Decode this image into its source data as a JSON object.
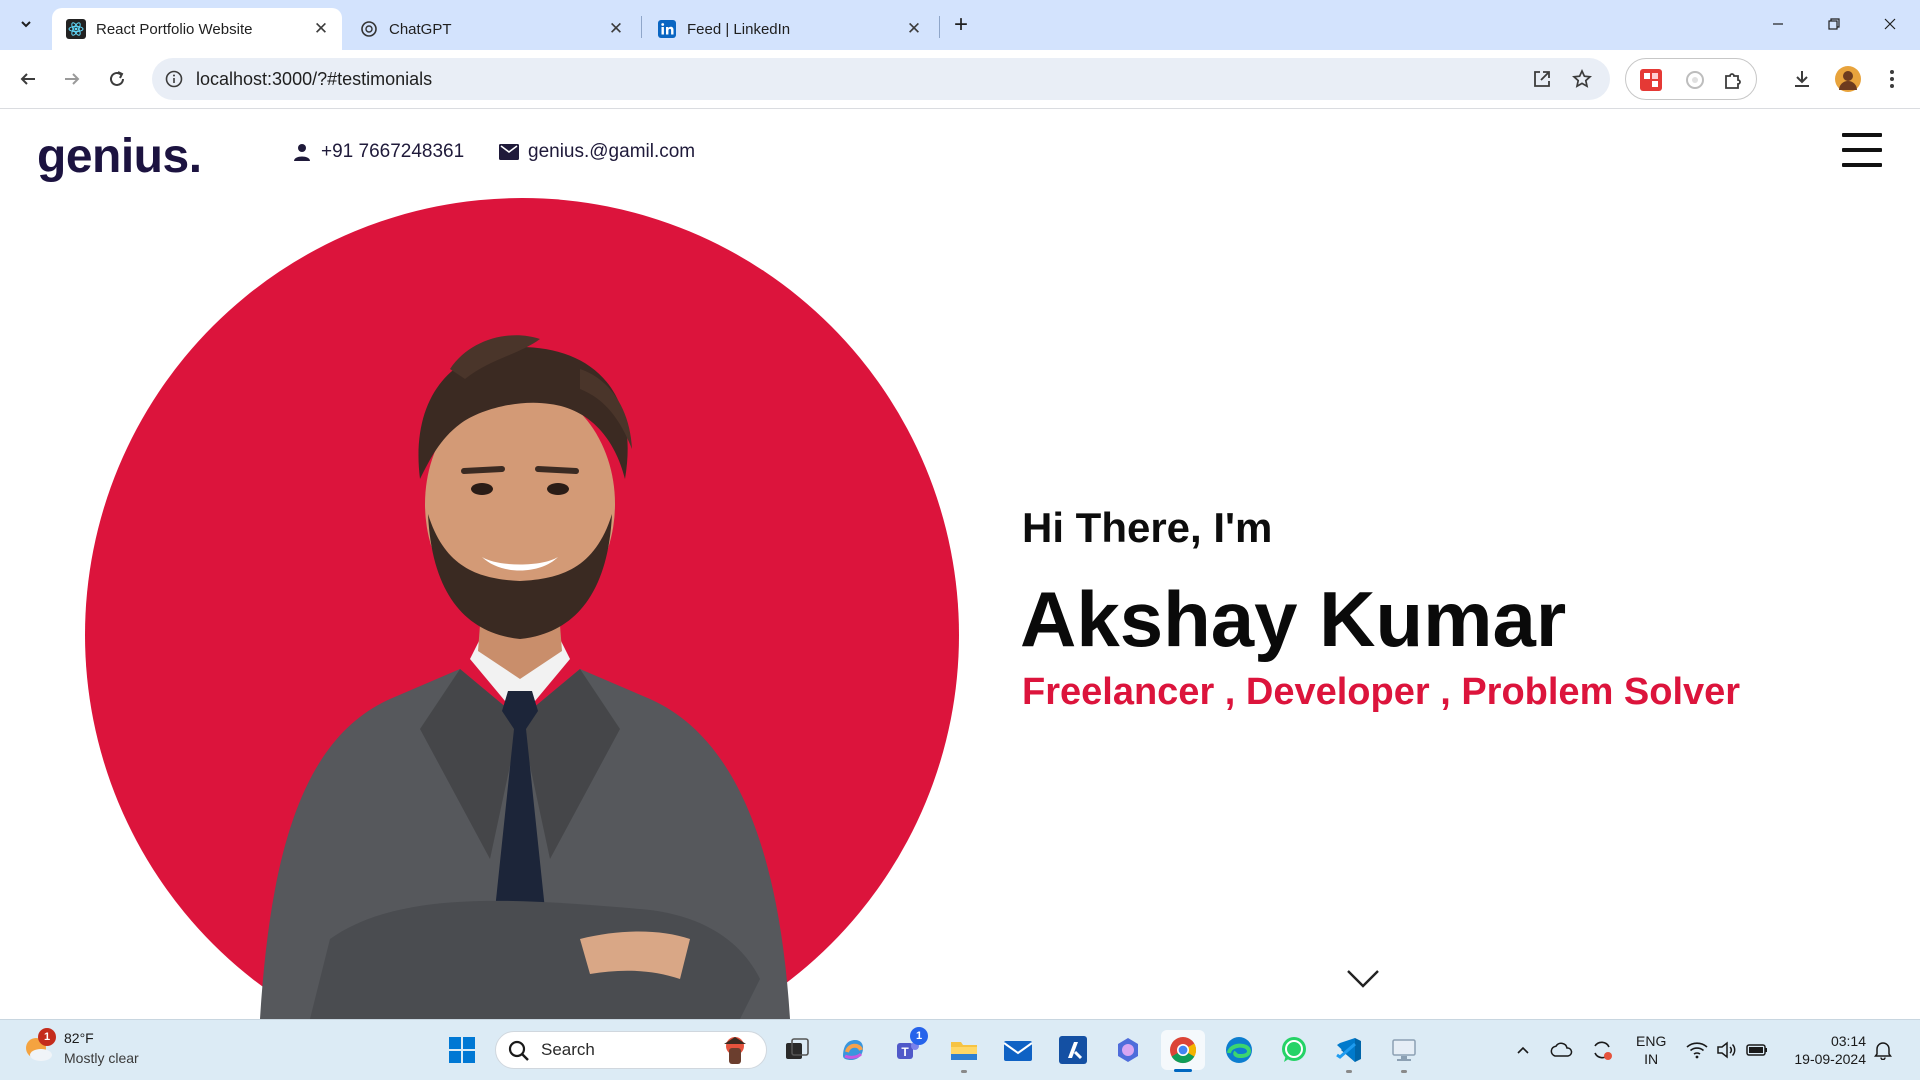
{
  "browser": {
    "tabs": [
      {
        "title": "React Portfolio Website",
        "icon": "react-icon",
        "active": true
      },
      {
        "title": "ChatGPT",
        "icon": "chatgpt-icon",
        "active": false
      },
      {
        "title": "Feed | LinkedIn",
        "icon": "linkedin-icon",
        "active": false
      }
    ],
    "url": "localhost:3000/?#testimonials"
  },
  "site": {
    "logo": "genius.",
    "phone": "+91 7667248361",
    "email": "genius.@gamil.com",
    "hero": {
      "greeting": "Hi There, I'm",
      "name": "Akshay Kumar",
      "tagline": "Freelancer , Developer , Problem Solver"
    },
    "colors": {
      "accent": "#dc143c",
      "logo": "#1c1340"
    }
  },
  "taskbar": {
    "weather": {
      "temp": "82°F",
      "desc": "Mostly clear",
      "badge": "1"
    },
    "search_placeholder": "Search",
    "teams_badge": "1",
    "language": {
      "line1": "ENG",
      "line2": "IN"
    },
    "clock": {
      "time": "03:14",
      "date": "19-09-2024"
    }
  }
}
